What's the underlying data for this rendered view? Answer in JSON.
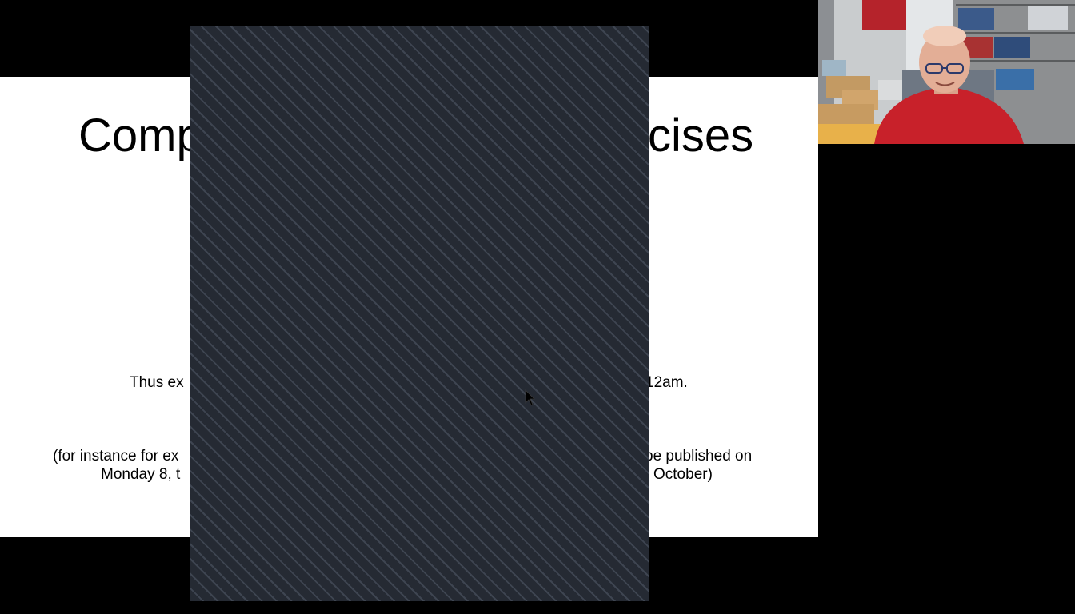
{
  "slide": {
    "title_left": "Comp",
    "title_right": "cises",
    "line1_left": "Thus ex",
    "line1_right": "12am.",
    "line2_left": "(for instance for ex",
    "line2_right": "be published on",
    "line3_left": "Monday 8, t",
    "line3_right": "October)"
  },
  "icons": {
    "cursor": "mouse-pointer-icon"
  },
  "colors": {
    "overlay": "#252a33",
    "overlay_stripe": "#3e4551",
    "background": "#000000",
    "slide": "#ffffff",
    "shirt": "#c8212a"
  }
}
